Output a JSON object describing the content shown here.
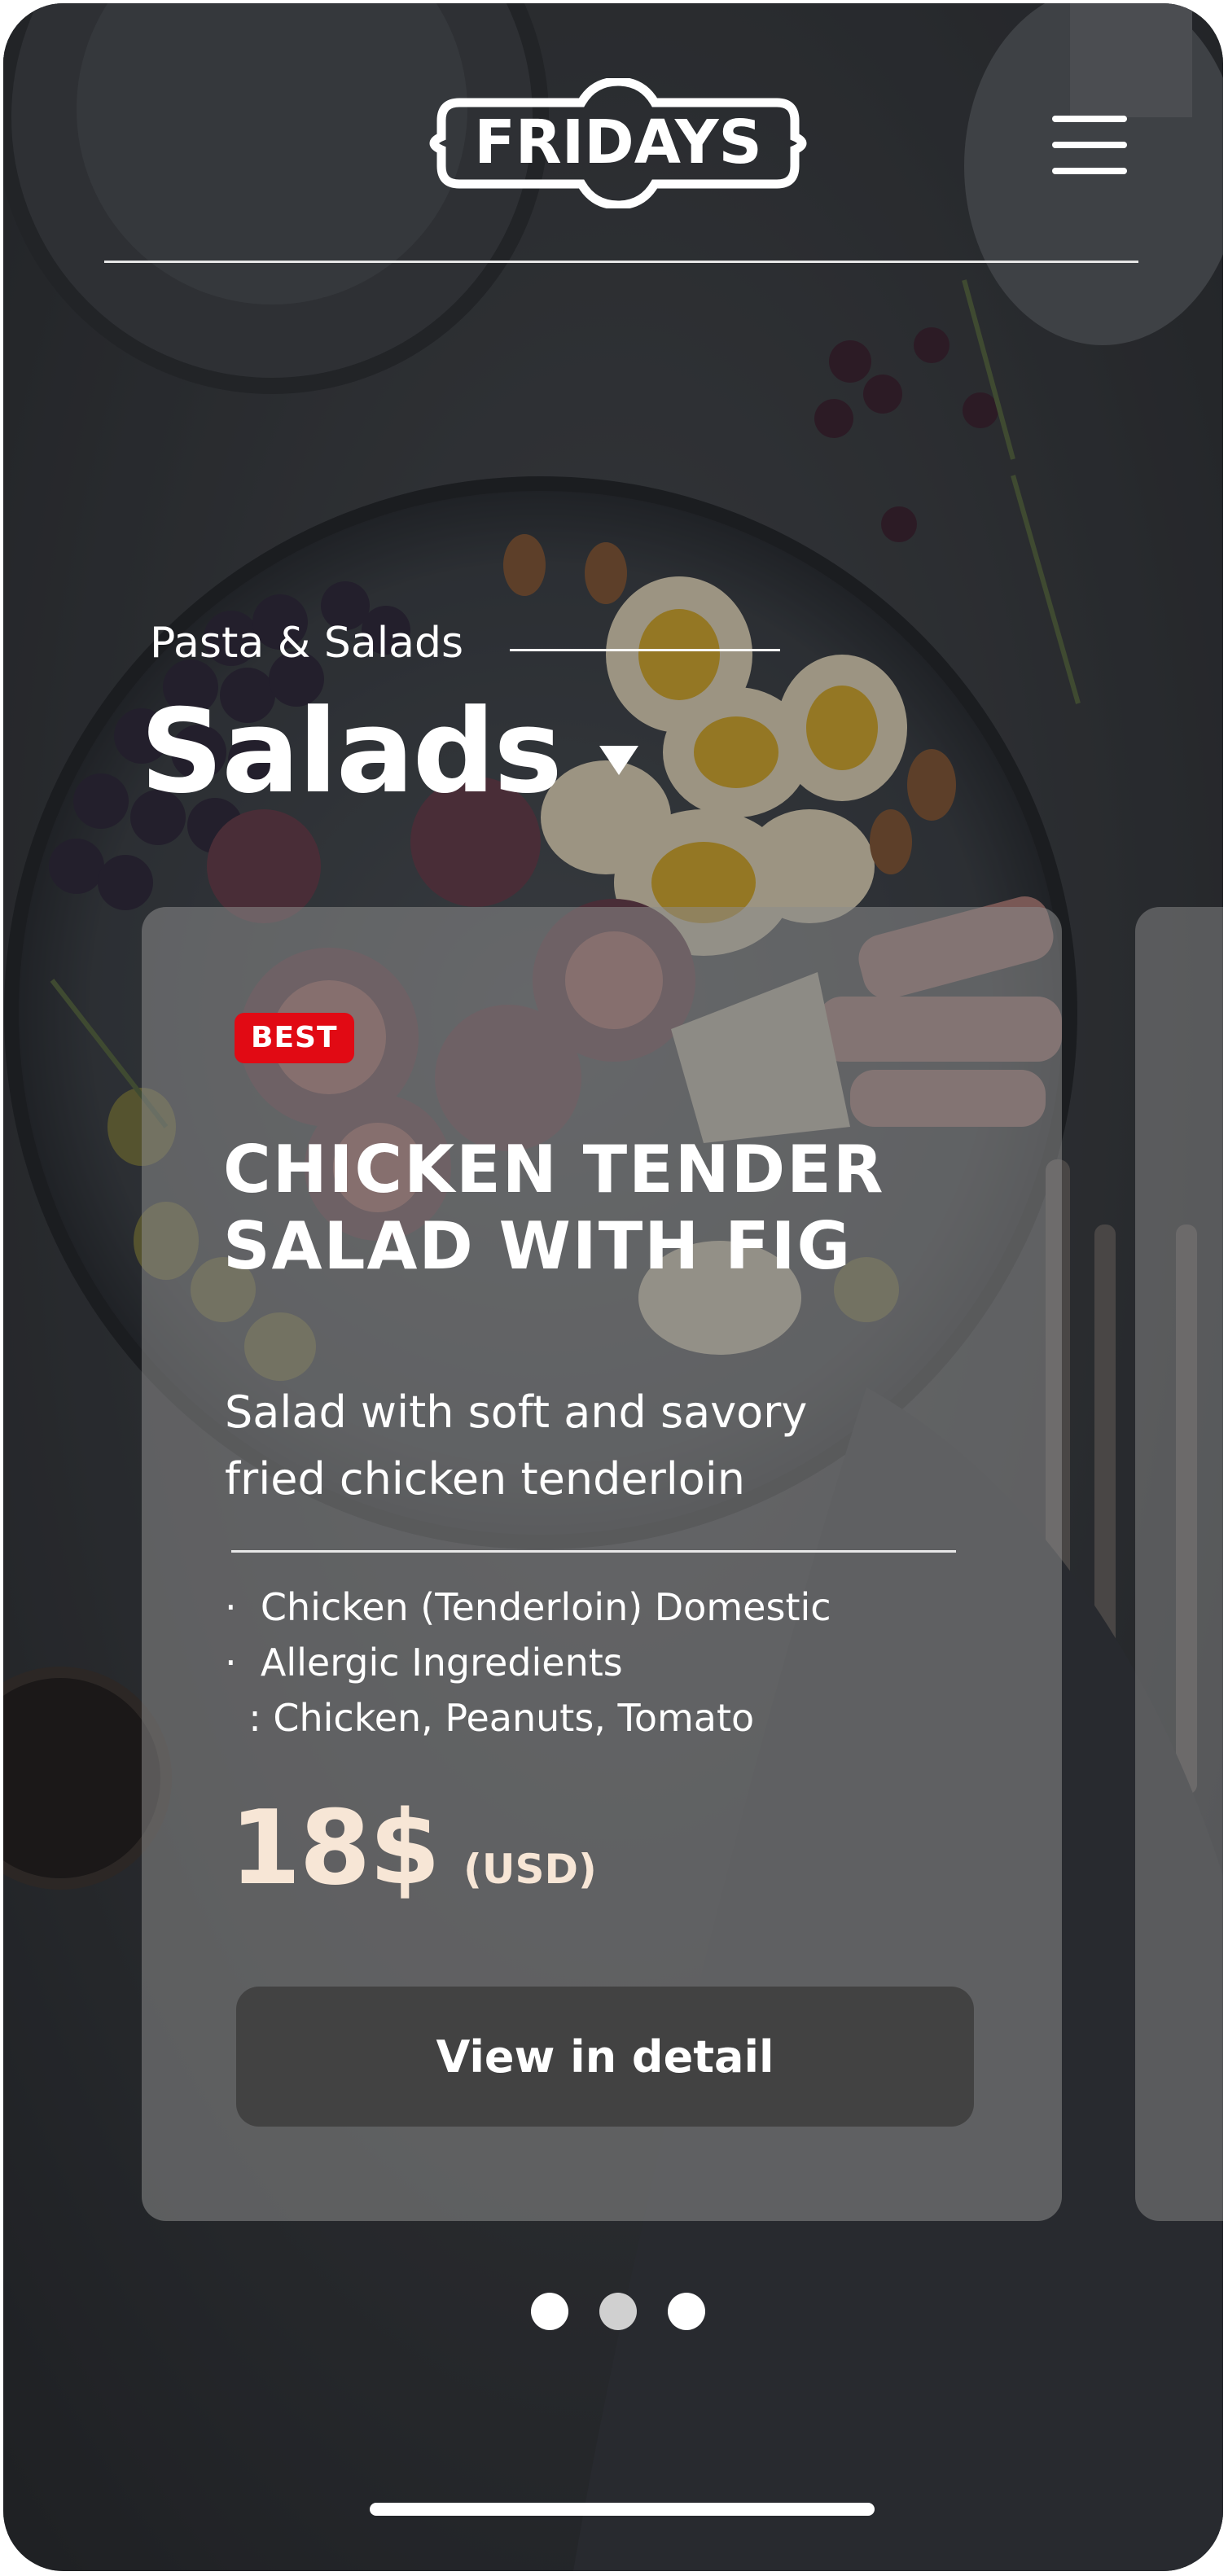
{
  "header": {
    "logo_text": "FRIDAYS",
    "menu_icon": "hamburger-menu-icon"
  },
  "category": {
    "label": "Pasta & Salads",
    "title": "Salads",
    "dropdown_icon": "caret-down-icon"
  },
  "card": {
    "badge": "BEST",
    "name_line1": "CHICKEN TENDER",
    "name_line2": "SALAD WITH FIG",
    "desc_line1": "Salad with soft and savory",
    "desc_line2": "fried chicken tenderloin",
    "info": [
      "·  Chicken (Tenderloin) Domestic",
      "·  Allergic Ingredients",
      "  : Chicken, Peanuts, Tomato"
    ],
    "price": "18$",
    "currency": "(USD)",
    "button_label": "View in detail"
  },
  "pagination": {
    "count": 3,
    "active_index": 1
  },
  "colors": {
    "badge": "#e10a14",
    "price": "#f7e6d6",
    "button": "#424242",
    "card": "rgba(140,140,140,0.55)"
  }
}
